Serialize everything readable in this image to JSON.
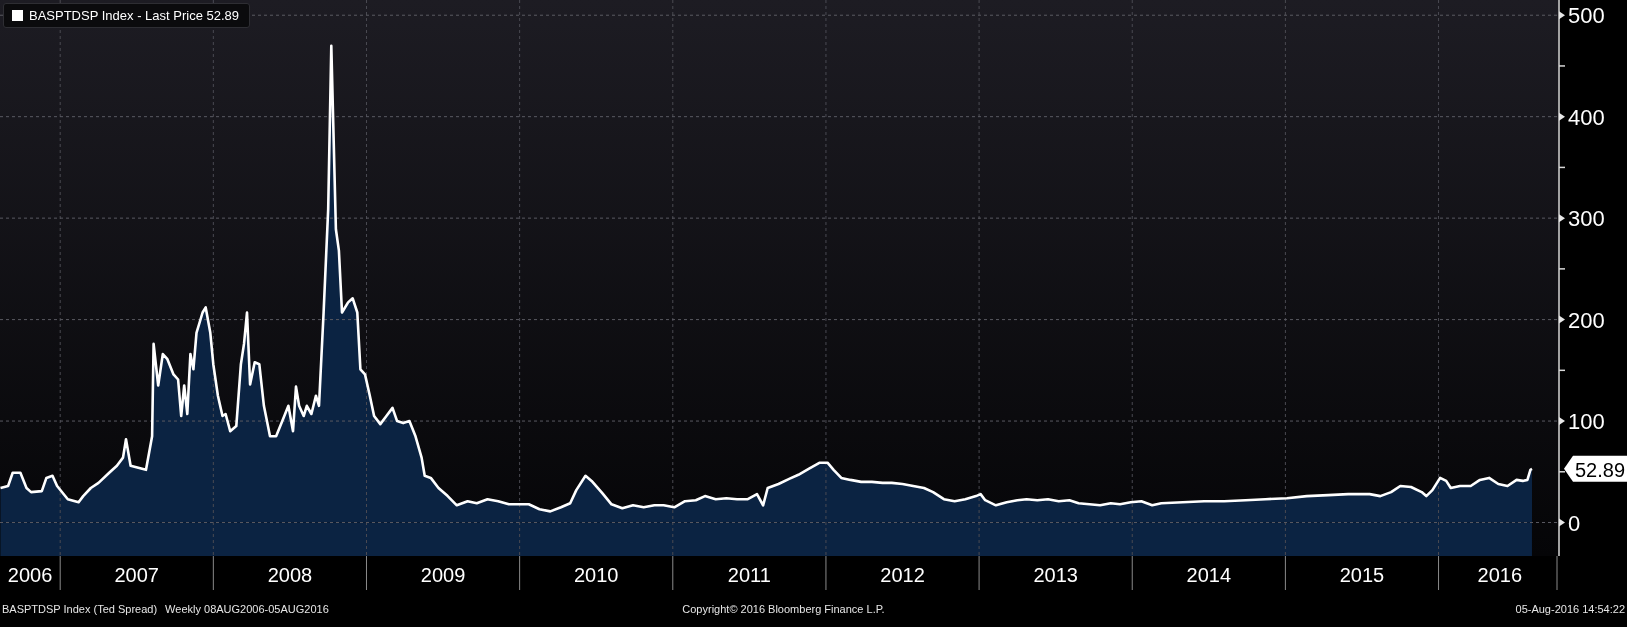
{
  "chart": {
    "chart_data": {
      "type": "area",
      "xlim": [
        2006.607,
        2016.78
      ],
      "ylim": [
        -33,
        515
      ],
      "grid": true,
      "yticks": [
        0,
        100,
        200,
        300,
        400,
        500
      ],
      "xticks": [
        {
          "value": 2007.5,
          "label": "2007"
        },
        {
          "value": 2008.5,
          "label": "2008"
        },
        {
          "value": 2009.5,
          "label": "2009"
        },
        {
          "value": 2010.5,
          "label": "2010"
        },
        {
          "value": 2011.5,
          "label": "2011"
        },
        {
          "value": 2012.5,
          "label": "2012"
        },
        {
          "value": 2013.5,
          "label": "2013"
        },
        {
          "value": 2014.5,
          "label": "2014"
        },
        {
          "value": 2015.5,
          "label": "2015"
        },
        {
          "value": 2016.4,
          "label": "2016"
        }
      ],
      "x": [
        2006.61,
        2006.66,
        2006.69,
        2006.74,
        2006.78,
        2006.81,
        2006.88,
        2006.91,
        2006.95,
        2006.98,
        2007.05,
        2007.12,
        2007.15,
        2007.2,
        2007.25,
        2007.32,
        2007.37,
        2007.41,
        2007.43,
        2007.46,
        2007.56,
        2007.6,
        2007.61,
        2007.64,
        2007.67,
        2007.7,
        2007.74,
        2007.77,
        2007.79,
        2007.81,
        2007.83,
        2007.85,
        2007.87,
        2007.89,
        2007.93,
        2007.95,
        2007.98,
        2008.0,
        2008.03,
        2008.06,
        2008.08,
        2008.11,
        2008.15,
        2008.18,
        2008.2,
        2008.22,
        2008.24,
        2008.27,
        2008.3,
        2008.33,
        2008.37,
        2008.41,
        2008.45,
        2008.49,
        2008.52,
        2008.54,
        2008.56,
        2008.59,
        2008.61,
        2008.64,
        2008.67,
        2008.69,
        2008.72,
        2008.75,
        2008.77,
        2008.8,
        2008.82,
        2008.84,
        2008.88,
        2008.91,
        2008.94,
        2008.96,
        2008.99,
        2009.02,
        2009.05,
        2009.09,
        2009.13,
        2009.17,
        2009.2,
        2009.24,
        2009.28,
        2009.32,
        2009.36,
        2009.38,
        2009.42,
        2009.47,
        2009.53,
        2009.59,
        2009.66,
        2009.72,
        2009.79,
        2009.86,
        2009.93,
        2009.99,
        2010.06,
        2010.13,
        2010.2,
        2010.27,
        2010.33,
        2010.37,
        2010.43,
        2010.47,
        2010.54,
        2010.6,
        2010.67,
        2010.74,
        2010.81,
        2010.88,
        2010.94,
        2011.01,
        2011.08,
        2011.15,
        2011.21,
        2011.28,
        2011.35,
        2011.42,
        2011.49,
        2011.55,
        2011.59,
        2011.62,
        2011.69,
        2011.76,
        2011.82,
        2011.89,
        2011.96,
        2012.01,
        2012.05,
        2012.1,
        2012.16,
        2012.23,
        2012.3,
        2012.37,
        2012.43,
        2012.5,
        2012.57,
        2012.64,
        2012.7,
        2012.77,
        2012.84,
        2012.91,
        2012.98,
        2013.01,
        2013.04,
        2013.11,
        2013.18,
        2013.25,
        2013.31,
        2013.38,
        2013.45,
        2013.52,
        2013.59,
        2013.65,
        2013.72,
        2013.79,
        2013.86,
        2013.92,
        2013.99,
        2014.06,
        2014.13,
        2014.19,
        2014.33,
        2014.47,
        2014.6,
        2014.74,
        2014.87,
        2015.01,
        2015.14,
        2015.28,
        2015.41,
        2015.55,
        2015.62,
        2015.69,
        2015.75,
        2015.82,
        2015.89,
        2015.92,
        2015.96,
        2016.01,
        2016.05,
        2016.08,
        2016.14,
        2016.21,
        2016.27,
        2016.33,
        2016.39,
        2016.45,
        2016.51,
        2016.55,
        2016.58,
        2016.6,
        2016.61
      ],
      "series": [
        {
          "name": "BASPTDSP Index - Last Price 52.89",
          "color": "#ffffff",
          "values": [
            34,
            36,
            49,
            49,
            34,
            30,
            31,
            44,
            46,
            36,
            23,
            20,
            26,
            34,
            39,
            49,
            56,
            64,
            82,
            56,
            52,
            85,
            176,
            135,
            166,
            161,
            146,
            141,
            105,
            135,
            107,
            166,
            151,
            187,
            207,
            212,
            187,
            156,
            125,
            105,
            107,
            90,
            95,
            156,
            176,
            207,
            136,
            158,
            156,
            115,
            85,
            85,
            100,
            115,
            90,
            134,
            115,
            105,
            115,
            107,
            125,
            115,
            207,
            309,
            470,
            289,
            268,
            207,
            217,
            221,
            207,
            151,
            146,
            126,
            105,
            97,
            105,
            113,
            100,
            98,
            100,
            85,
            64,
            46,
            44,
            34,
            26,
            17,
            21,
            19,
            23,
            21,
            18,
            18,
            18,
            13,
            11,
            15,
            19,
            32,
            46,
            41,
            29,
            18,
            14,
            17,
            15,
            17,
            17,
            15,
            21,
            22,
            26,
            23,
            24,
            23,
            23,
            28,
            17,
            34,
            38,
            43,
            47,
            53,
            59,
            59,
            52,
            44,
            42,
            40,
            40,
            39,
            39,
            38,
            36,
            34,
            30,
            23,
            21,
            23,
            26,
            28,
            22,
            17,
            20,
            22,
            23,
            22,
            23,
            21,
            22,
            19,
            18,
            17,
            19,
            18,
            20,
            21,
            17,
            19,
            20,
            21,
            21,
            22,
            23,
            24,
            26,
            27,
            28,
            28,
            26,
            30,
            36,
            35,
            30,
            26,
            32,
            44,
            41,
            34,
            36,
            36,
            42,
            44,
            38,
            36,
            42,
            41,
            42,
            52,
            52.89
          ]
        }
      ]
    },
    "first_year_label": "2006",
    "last_value_tag": "52.89"
  },
  "footer": {
    "left": [
      "BASPTDSP Index (Ted Spread)",
      "Weekly 08AUG2006-05AUG2016"
    ],
    "center": "Copyright© 2016 Bloomberg Finance L.P.",
    "right": "05-Aug-2016 14:54:22"
  }
}
